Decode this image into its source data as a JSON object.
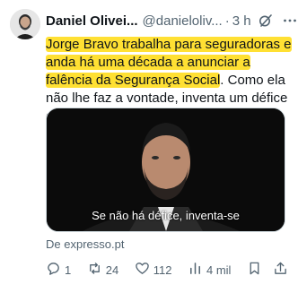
{
  "tweet": {
    "author_name": "Daniel Olivei...",
    "handle": "@danieloliv...",
    "separator": "·",
    "time": "3 h",
    "text_highlighted": "Jorge Bravo trabalha para seguradoras e anda há uma década a anunciar a falência da Segurança Social",
    "text_rest": ". Como ela não lhe faz a vontade, inventa um défice escondido.",
    "highlight_color": "#ffe033"
  },
  "media": {
    "caption": "Se não há défice, inventa-se"
  },
  "source_card": {
    "label": "De expresso.pt"
  },
  "actions": {
    "replies": "1",
    "reposts": "24",
    "likes": "112",
    "views": "4 mil"
  },
  "icons": {
    "reply": "reply-icon",
    "repost": "repost-icon",
    "like": "heart-icon",
    "views": "views-icon",
    "bookmark": "bookmark-icon",
    "share": "share-icon",
    "grok": "grok-icon",
    "more": "more-icon"
  },
  "colors": {
    "text": "#0f1419",
    "secondary": "#536471"
  }
}
